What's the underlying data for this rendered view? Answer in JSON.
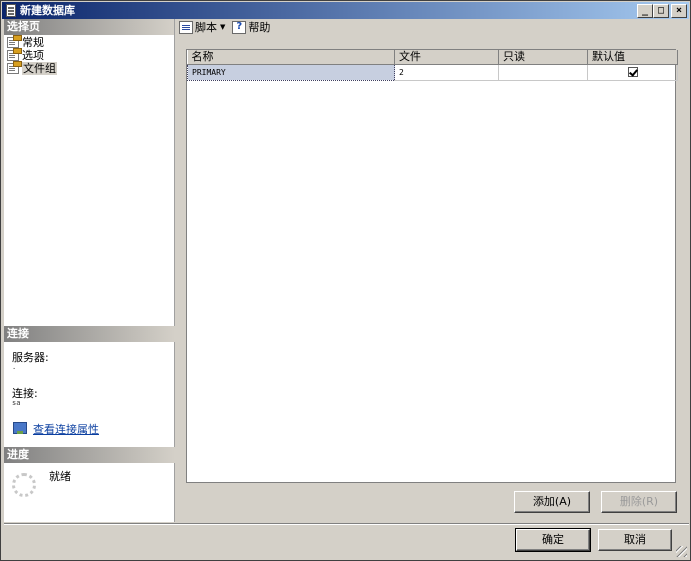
{
  "window": {
    "title": "新建数据库",
    "min_label": "_",
    "max_label": "□",
    "close_label": "×"
  },
  "left": {
    "select_page_header": "选择页",
    "pages": [
      {
        "label": "常规",
        "selected": false
      },
      {
        "label": "选项",
        "selected": false
      },
      {
        "label": "文件组",
        "selected": true
      }
    ],
    "connection_header": "连接",
    "server_label": "服务器:",
    "server_value": ".",
    "connection_label": "连接:",
    "connection_value": "sa",
    "view_connection_link": "查看连接属性",
    "progress_header": "进度",
    "progress_status": "就绪"
  },
  "toolbar": {
    "script_label": "脚本",
    "help_label": "帮助"
  },
  "grid": {
    "columns": [
      "名称",
      "文件",
      "只读",
      "默认值"
    ],
    "rows": [
      {
        "name": "PRIMARY",
        "files": "2",
        "readonly": false,
        "default": true
      }
    ]
  },
  "buttons": {
    "add": "添加(A)",
    "remove": "删除(R)",
    "ok": "确定",
    "cancel": "取消"
  }
}
